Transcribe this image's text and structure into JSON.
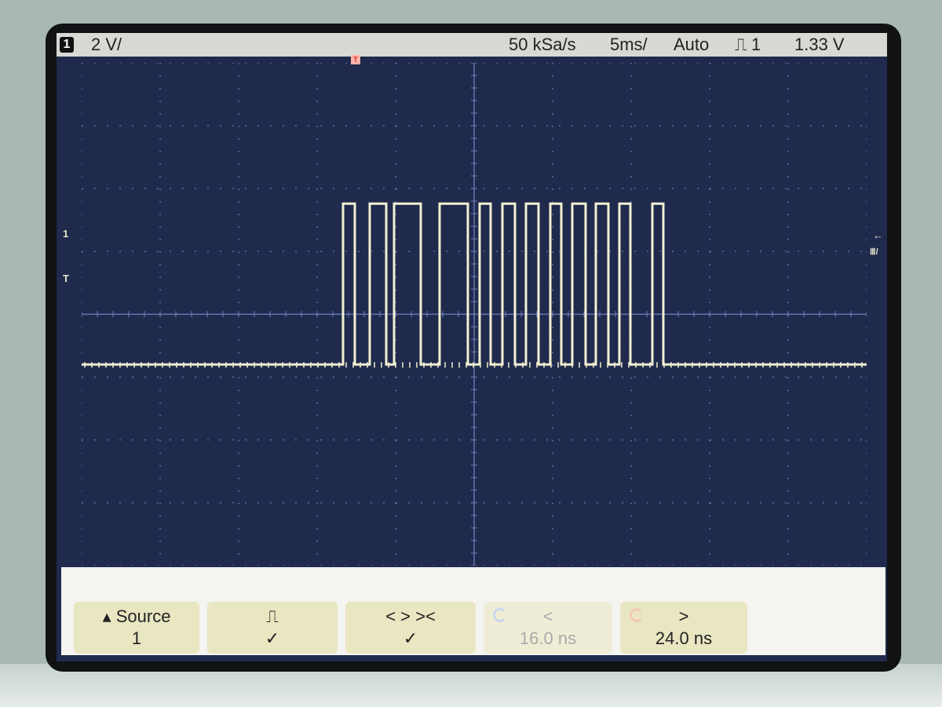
{
  "status_bar": {
    "channel": "1",
    "scale": "2 V/",
    "sample_rate": "50 kSa/s",
    "time_scale": "5ms/",
    "trigger_mode": "Auto",
    "trigger_icon": "⎍",
    "trigger_channel": "1",
    "trigger_level": "1.33 V"
  },
  "markers": {
    "trigger_position": "T",
    "channel1_ground": "1",
    "trigger_level_marker": "T",
    "right_arrow": "←",
    "right_label": "Ⅲ/"
  },
  "softkeys": [
    {
      "line1": "▴ Source",
      "line2": "1"
    },
    {
      "line1": "⎍",
      "line2": "✓"
    },
    {
      "line1": "< > ><",
      "line2": "✓"
    },
    {
      "line1": "<",
      "line2": "16.0 ns"
    },
    {
      "line1": ">",
      "line2": "24.0 ns"
    }
  ],
  "trace": {
    "color": "#f2f0d2",
    "low_level_y": 0.6,
    "high_level_y": 0.28,
    "pulses": [
      [
        0.333,
        0.348
      ],
      [
        0.367,
        0.388
      ],
      [
        0.398,
        0.432
      ],
      [
        0.456,
        0.492
      ],
      [
        0.507,
        0.521
      ],
      [
        0.536,
        0.552
      ],
      [
        0.566,
        0.582
      ],
      [
        0.597,
        0.611
      ],
      [
        0.625,
        0.642
      ],
      [
        0.655,
        0.671
      ],
      [
        0.685,
        0.699
      ],
      [
        0.727,
        0.741
      ]
    ]
  }
}
